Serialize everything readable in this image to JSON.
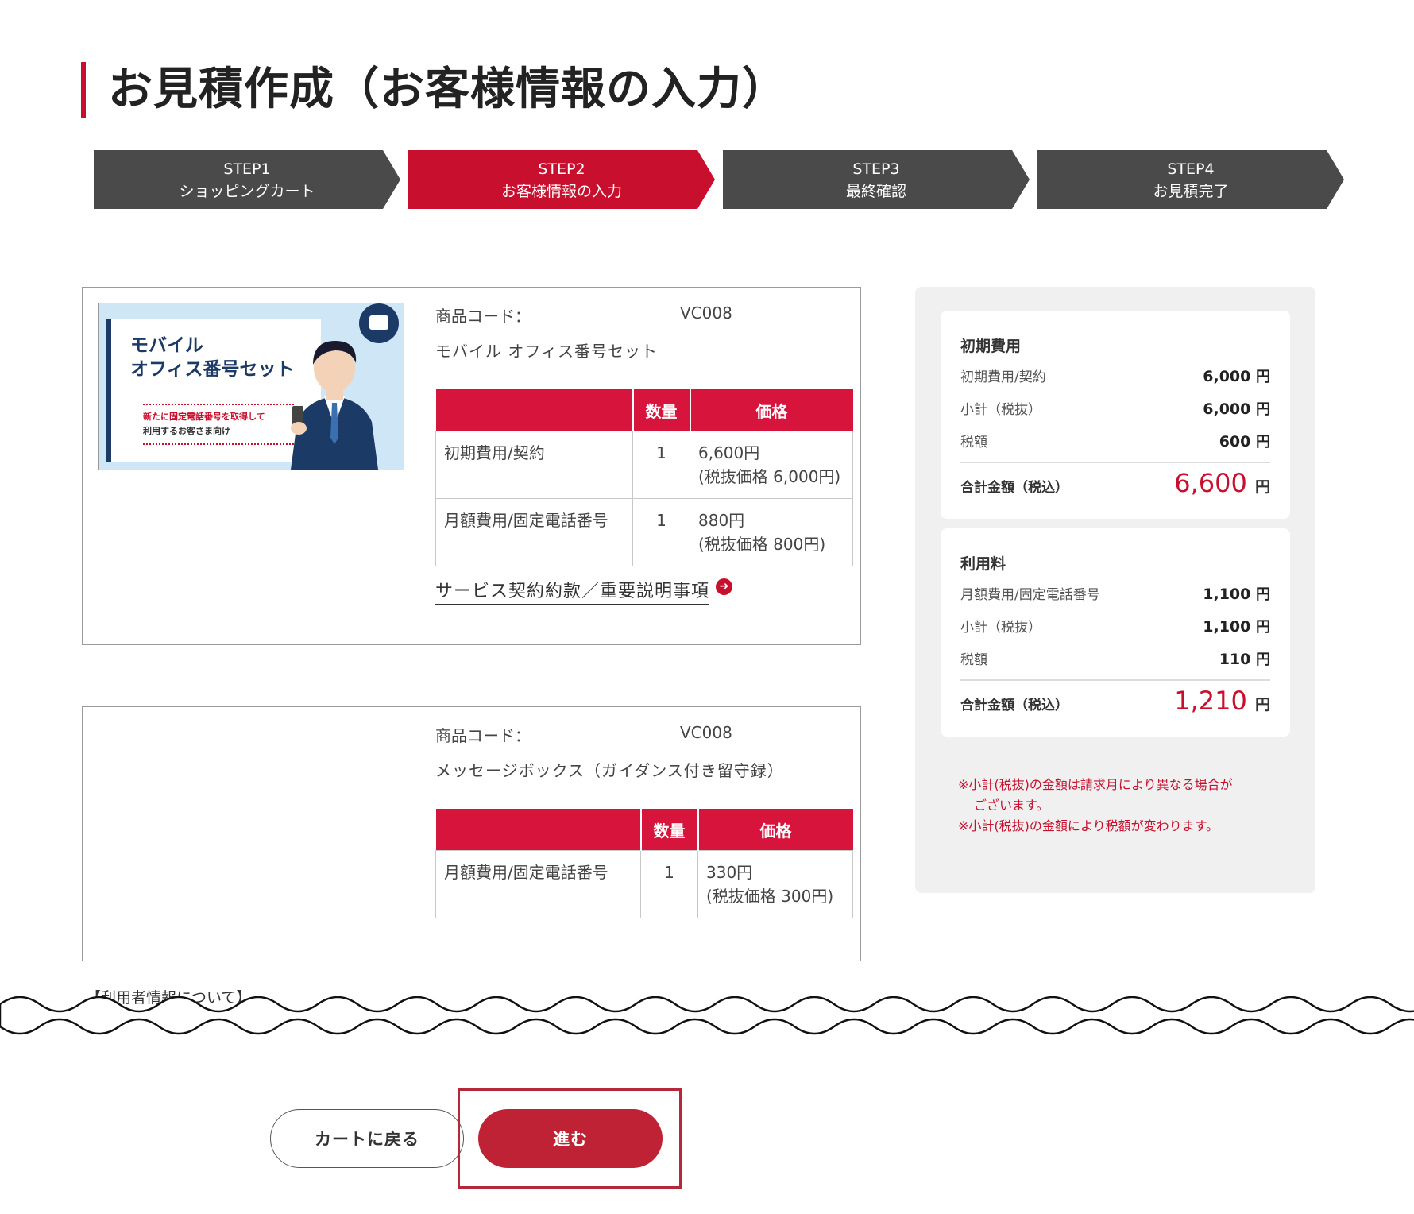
{
  "page": {
    "title": "お見積作成（お客様情報の入力）"
  },
  "steps": [
    {
      "step": "STEP1",
      "label": "ショッピングカート",
      "active": false
    },
    {
      "step": "STEP2",
      "label": "お客様情報の入力",
      "active": true
    },
    {
      "step": "STEP3",
      "label": "最終確認",
      "active": false
    },
    {
      "step": "STEP4",
      "label": "お見積完了",
      "active": false
    }
  ],
  "products": [
    {
      "code_label": "商品コード：",
      "code": "VC008",
      "name": "モバイル オフィス番号セット",
      "image": {
        "title_line1": "モバイル",
        "title_line2": "オフィス番号セット",
        "sub_line1": "新たに固定電話番号を取得して",
        "sub_line2": "利用するお客さま向け"
      },
      "table": {
        "headers": [
          "",
          "数量",
          "価格"
        ],
        "rows": [
          {
            "item": "初期費用/契約",
            "qty": "1",
            "price": "6,600円",
            "price_ex": "(税抜価格 6,000円)"
          },
          {
            "item": "月額費用/固定電話番号",
            "qty": "1",
            "price": "880円",
            "price_ex": "(税抜価格 800円)"
          }
        ]
      },
      "terms_link": "サービス契約約款／重要説明事項"
    },
    {
      "code_label": "商品コード：",
      "code": "VC008",
      "name": "メッセージボックス（ガイダンス付き留守録）",
      "table": {
        "headers": [
          "",
          "数量",
          "価格"
        ],
        "rows": [
          {
            "item": "月額費用/固定電話番号",
            "qty": "1",
            "price": "330円",
            "price_ex": "(税抜価格 300円)"
          }
        ]
      }
    }
  ],
  "summary": {
    "initial": {
      "heading": "初期費用",
      "rows": [
        {
          "label": "初期費用/契約",
          "value": "6,000",
          "unit": "円"
        },
        {
          "label": "小計（税抜）",
          "value": "6,000",
          "unit": "円"
        },
        {
          "label": "税額",
          "value": "600",
          "unit": "円"
        }
      ],
      "total_label": "合計金額（税込）",
      "total_value": "6,600",
      "total_unit": "円"
    },
    "usage": {
      "heading": "利用料",
      "rows": [
        {
          "label": "月額費用/固定電話番号",
          "value": "1,100",
          "unit": "円"
        },
        {
          "label": "小計（税抜）",
          "value": "1,100",
          "unit": "円"
        },
        {
          "label": "税額",
          "value": "110",
          "unit": "円"
        }
      ],
      "total_label": "合計金額（税込）",
      "total_value": "1,210",
      "total_unit": "円"
    },
    "note_line1": "※小計(税抜)の金額は請求月により異なる場合が",
    "note_line2": "ございます。",
    "note_line3": "※小計(税抜)の金額により税額が変わります。"
  },
  "user_info_heading": "【利用者情報について】",
  "buttons": {
    "back": "カートに戻る",
    "next": "進む"
  },
  "colors": {
    "accent": "#c8102e",
    "step_inactive": "#4a4a4a",
    "table_header": "#d7143c",
    "panel_bg": "#f0f0f0"
  }
}
